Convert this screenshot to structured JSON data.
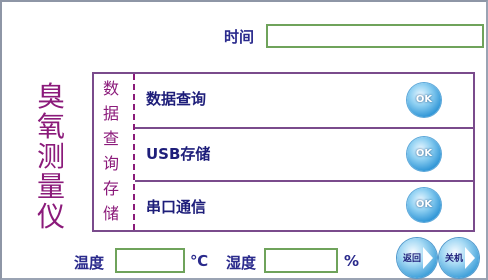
{
  "header": {
    "time_label": "时间",
    "time_value": ""
  },
  "title": {
    "chars": [
      "臭",
      "氧",
      "测",
      "量",
      "仪"
    ]
  },
  "menu": {
    "group_chars": [
      "数",
      "据",
      "查",
      "询",
      "存",
      "储"
    ],
    "items": [
      {
        "label": "数据查询",
        "button": "OK"
      },
      {
        "label": "USB存储",
        "button": "OK"
      },
      {
        "label": "串口通信",
        "button": "OK"
      }
    ]
  },
  "footer": {
    "temp_label": "温度",
    "temp_value": "",
    "temp_unit": "℃",
    "humidity_label": "湿度",
    "humidity_value": "",
    "humidity_unit": "%",
    "back_label": "返回",
    "shutdown_label": "关机"
  }
}
